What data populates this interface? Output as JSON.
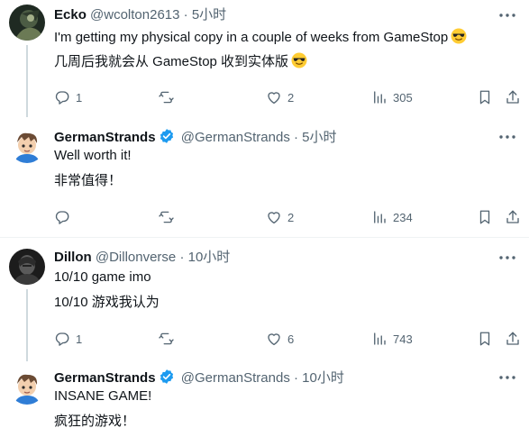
{
  "posts": [
    {
      "name": "Ecko",
      "handle": "@wcolton2613",
      "sep": "·",
      "time": "5小时",
      "verified": false,
      "text": "I'm getting my physical copy in a couple of weeks from GameStop",
      "translation": "几周后我就会从 GameStop 收到实体版",
      "emoji": "smiling-face-with-sunglasses",
      "replies": "1",
      "reposts": "",
      "likes": "2",
      "views": "305"
    },
    {
      "name": "GermanStrands",
      "handle": "@GermanStrands",
      "sep": "·",
      "time": "5小时",
      "verified": true,
      "text": "Well worth it!",
      "translation": "非常值得！",
      "replies": "",
      "reposts": "",
      "likes": "2",
      "views": "234"
    },
    {
      "name": "Dillon",
      "handle": "@Dillonverse",
      "sep": "·",
      "time": "10小时",
      "verified": false,
      "text": "10/10 game imo",
      "translation": "10/10 游戏我认为",
      "replies": "1",
      "reposts": "",
      "likes": "6",
      "views": "743"
    },
    {
      "name": "GermanStrands",
      "handle": "@GermanStrands",
      "sep": "·",
      "time": "10小时",
      "verified": true,
      "text": "INSANE GAME!",
      "translation": "疯狂的游戏！"
    }
  ],
  "colors": {
    "text": "#0f1419",
    "muted": "#536471",
    "verified": "#1d9bf0",
    "thread_line": "#cfd9de",
    "divider": "#eff3f4"
  }
}
